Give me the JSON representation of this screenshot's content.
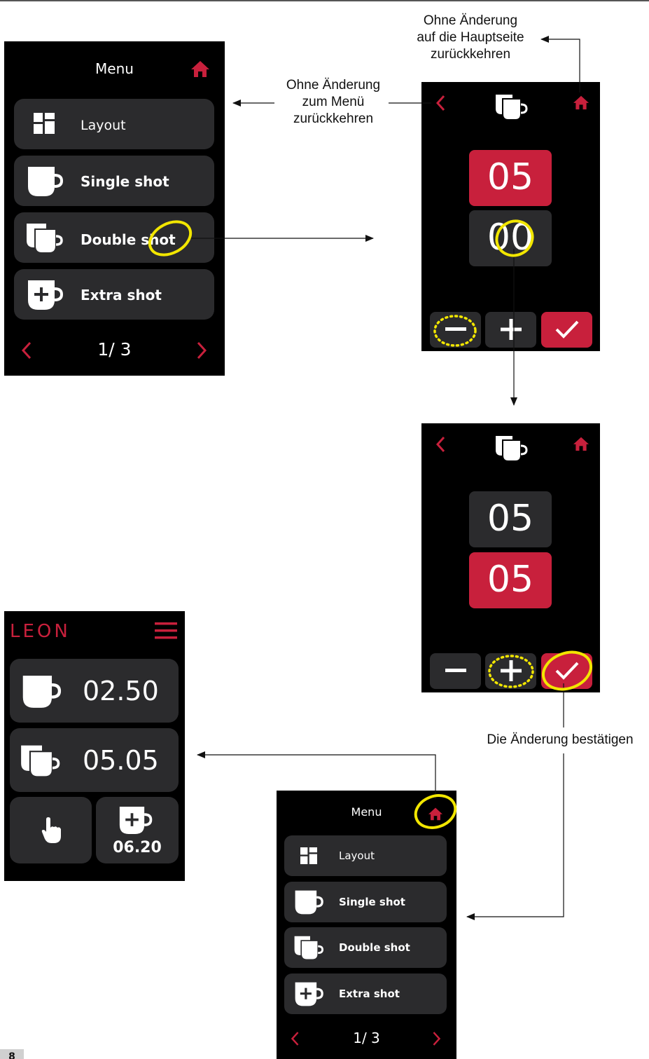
{
  "menu_screen": {
    "title": "Menu",
    "items": [
      {
        "label": "Layout",
        "icon": "layout-icon"
      },
      {
        "label": "Single shot",
        "icon": "single-cup-icon"
      },
      {
        "label": "Double shot",
        "icon": "double-cup-icon"
      },
      {
        "label": "Extra shot",
        "icon": "extra-shot-icon"
      }
    ],
    "pagination": "1/ 3"
  },
  "edit_screen_1": {
    "top_value": "05",
    "bottom_value": "00",
    "minus": "−",
    "plus": "+"
  },
  "edit_screen_2": {
    "top_value": "05",
    "bottom_value": "05"
  },
  "main_screen": {
    "brand": "LEON",
    "single_time": "02.50",
    "double_time": "05.05",
    "extra_time": "06.20"
  },
  "annotations": {
    "home_return": [
      "Ohne Änderung",
      "auf die Hauptseite",
      "zurückkehren"
    ],
    "menu_return": [
      "Ohne Änderung",
      "zum Menü",
      "zurückkehren"
    ],
    "confirm": "Die Änderung bestätigen"
  },
  "page_number": "8",
  "colors": {
    "accent_red": "#c8203c",
    "highlight_yellow": "#f2e600",
    "screen_bg": "#000000",
    "button_bg": "#2b2b2d"
  }
}
